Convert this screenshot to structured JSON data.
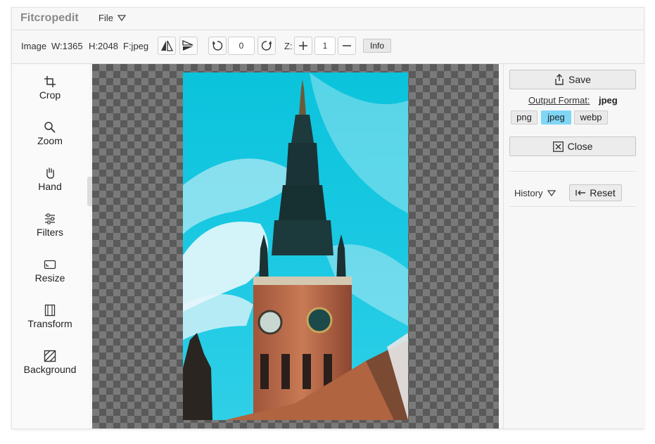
{
  "app": {
    "title": "Fitcropedit"
  },
  "menu": {
    "file_label": "File"
  },
  "toolbar": {
    "image_label": "Image",
    "width": "W:1365",
    "height": "H:2048",
    "format": "F:jpeg",
    "rotation_value": "0",
    "zoom_label": "Z:",
    "zoom_value": "1",
    "info_label": "Info"
  },
  "tools": [
    {
      "label": "Crop",
      "icon": "crop-icon"
    },
    {
      "label": "Zoom",
      "icon": "zoom-icon"
    },
    {
      "label": "Hand",
      "icon": "hand-icon"
    },
    {
      "label": "Filters",
      "icon": "filters-icon"
    },
    {
      "label": "Resize",
      "icon": "resize-icon"
    },
    {
      "label": "Transform",
      "icon": "transform-icon"
    },
    {
      "label": "Background",
      "icon": "background-icon"
    }
  ],
  "panel": {
    "save_label": "Save",
    "output_format_label": "Output Format:",
    "output_format_value": "jpeg",
    "formats": [
      "png",
      "jpeg",
      "webp"
    ],
    "selected_format": "jpeg",
    "close_label": "Close",
    "history_label": "History",
    "reset_label": "Reset"
  },
  "colors": {
    "selected_format_bg": "#7fd6f5",
    "sky": "#19c8e2"
  }
}
